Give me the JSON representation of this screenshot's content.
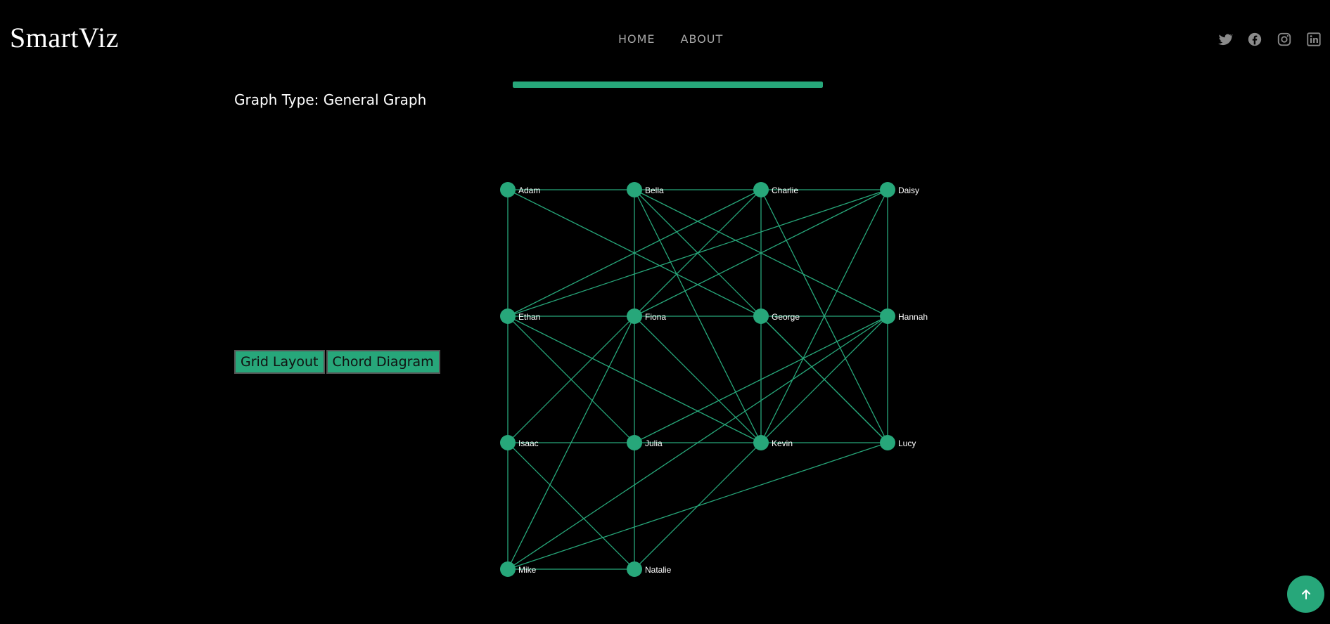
{
  "header": {
    "logo": "SmartViz",
    "nav": [
      {
        "label": "HOME"
      },
      {
        "label": "ABOUT"
      }
    ],
    "social_icons": [
      "twitter-icon",
      "facebook-icon",
      "instagram-icon",
      "linkedin-icon"
    ]
  },
  "progress": {
    "percent": 100
  },
  "graph_type": {
    "label": "Graph Type:",
    "value": "General Graph"
  },
  "layout_buttons": {
    "grid": "Grid Layout",
    "chord": "Chord Diagram"
  },
  "colors": {
    "accent": "#27a77a",
    "background": "#000000",
    "nav_text": "#a6a6a6"
  },
  "graph": {
    "nodes": [
      "Adam",
      "Bella",
      "Charlie",
      "Daisy",
      "Ethan",
      "Fiona",
      "George",
      "Hannah",
      "Isaac",
      "Julia",
      "Kevin",
      "Lucy",
      "Mike",
      "Natalie"
    ],
    "edges": [
      [
        "Adam",
        "Bella"
      ],
      [
        "Bella",
        "Charlie"
      ],
      [
        "Charlie",
        "Daisy"
      ],
      [
        "Adam",
        "Ethan"
      ],
      [
        "Bella",
        "Fiona"
      ],
      [
        "Charlie",
        "George"
      ],
      [
        "Daisy",
        "Hannah"
      ],
      [
        "Ethan",
        "Fiona"
      ],
      [
        "Fiona",
        "George"
      ],
      [
        "George",
        "Hannah"
      ],
      [
        "Ethan",
        "Isaac"
      ],
      [
        "Fiona",
        "Julia"
      ],
      [
        "George",
        "Kevin"
      ],
      [
        "Hannah",
        "Lucy"
      ],
      [
        "Isaac",
        "Julia"
      ],
      [
        "Julia",
        "Kevin"
      ],
      [
        "Kevin",
        "Lucy"
      ],
      [
        "Isaac",
        "Mike"
      ],
      [
        "Julia",
        "Natalie"
      ],
      [
        "Mike",
        "Natalie"
      ],
      [
        "Adam",
        "George"
      ],
      [
        "Bella",
        "Hannah"
      ],
      [
        "Bella",
        "Kevin"
      ],
      [
        "Bella",
        "Lucy"
      ],
      [
        "Charlie",
        "Ethan"
      ],
      [
        "Charlie",
        "Fiona"
      ],
      [
        "Charlie",
        "Lucy"
      ],
      [
        "Daisy",
        "Ethan"
      ],
      [
        "Daisy",
        "Fiona"
      ],
      [
        "Daisy",
        "Kevin"
      ],
      [
        "Ethan",
        "Julia"
      ],
      [
        "Ethan",
        "Kevin"
      ],
      [
        "Fiona",
        "Isaac"
      ],
      [
        "Fiona",
        "Kevin"
      ],
      [
        "Fiona",
        "Mike"
      ],
      [
        "George",
        "Lucy"
      ],
      [
        "Hannah",
        "Julia"
      ],
      [
        "Hannah",
        "Kevin"
      ],
      [
        "Hannah",
        "Mike"
      ],
      [
        "Isaac",
        "Natalie"
      ],
      [
        "Kevin",
        "Natalie"
      ],
      [
        "Lucy",
        "Mike"
      ]
    ]
  }
}
